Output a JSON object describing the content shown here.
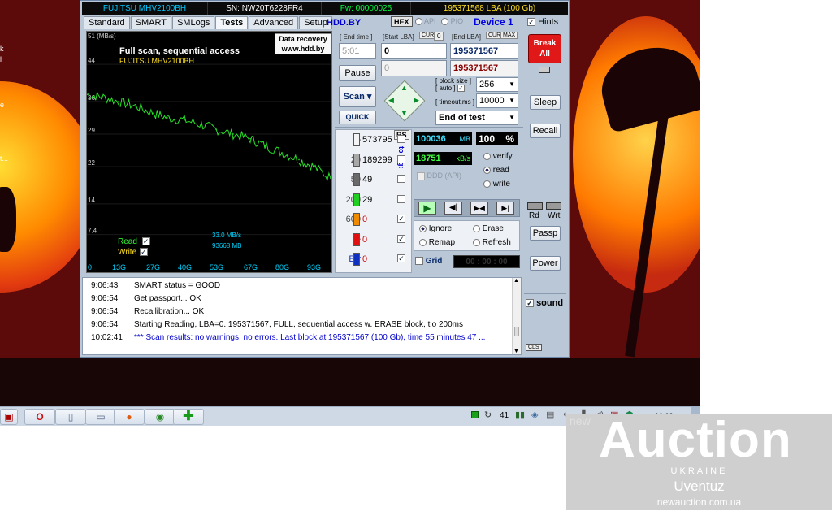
{
  "desktop": {
    "labels": [
      "k",
      "l",
      "e",
      "t..."
    ]
  },
  "header": {
    "model": "FUJITSU MHV2100BH",
    "serial": "SN: NW20T6228FR4",
    "firmware": "Fw: 00000025",
    "capacity": "195371568 LBA (100 Gb)"
  },
  "tabs": [
    "Standard",
    "SMART",
    "SMLogs",
    "Tests",
    "Advanced",
    "Setup"
  ],
  "active_tab": "Tests",
  "toolbar": {
    "site": "HDD.BY",
    "hex": "HEX",
    "api": "API",
    "pio": "PIO",
    "device": "Device 1",
    "hints": "Hints"
  },
  "graph": {
    "title": "Full scan, sequential access",
    "model": "FUJITSU MHV2100BH",
    "badge_line1": "Data recovery",
    "badge_line2": "www.hdd.by",
    "unit": "51 (MB/s)",
    "y_ticks": [
      "44",
      "36",
      "29",
      "22",
      "14",
      "7.4"
    ],
    "x_ticks": [
      "0",
      "13G",
      "27G",
      "40G",
      "53G",
      "67G",
      "80G",
      "93G"
    ],
    "speed": "33.0 MB/s",
    "position": "93668 MB",
    "read_label": "Read",
    "write_label": "Write"
  },
  "chart_data": {
    "type": "line",
    "title": "Full scan, sequential access",
    "x": [
      0,
      6,
      13,
      20,
      27,
      33,
      40,
      47,
      53,
      60,
      67,
      73,
      80,
      87,
      93,
      100
    ],
    "series": [
      {
        "name": "Read",
        "values": [
          37.5,
          37,
          36,
          35,
          33.5,
          32.5,
          32,
          31,
          30,
          29,
          28,
          26.5,
          25,
          23.5,
          22,
          19.5
        ]
      }
    ],
    "xlabel": "",
    "ylabel": "",
    "xlim": [
      0,
      100
    ],
    "ylim": [
      0,
      51
    ],
    "x_unit": "GB",
    "y_unit": "MB/s",
    "color": "#28e028"
  },
  "test": {
    "end_time_label": "[ End time ]",
    "start_lba_label": "[Start LBA]",
    "cur": "CUR",
    "zero": "0",
    "end_lba_label": "[End LBA]",
    "max": "MAX",
    "end_time": "5:01",
    "start_lba": "0",
    "end_lba": "195371567",
    "cur_lba": "0",
    "cur_end": "195371567",
    "pause": "Pause",
    "scan": "Scan",
    "quick": "QUICK",
    "block_size_label": "[ block size ]",
    "auto_label": "[ auto ]",
    "block_size": "256",
    "timeout_label": "[ timeout,ms ]",
    "timeout": "10000",
    "end_action": "End of test",
    "rs": "RS",
    "to_log": "to log:"
  },
  "legend": [
    {
      "ms": "5",
      "count": "573795",
      "color": "#f4f4f4"
    },
    {
      "ms": "20",
      "count": "189299",
      "color": "#a8a8a8"
    },
    {
      "ms": "50",
      "count": "49",
      "color": "#6a6a6a"
    },
    {
      "ms": "200",
      "count": "29",
      "color": "#20d020"
    },
    {
      "ms": "600",
      "count": "0",
      "color": "#f08a00"
    },
    {
      "ms": ">",
      "count": "0",
      "color": "#e01010"
    },
    {
      "ms": "Err",
      "count": "0",
      "color": "#1030c0"
    }
  ],
  "stats": {
    "mb": "100036",
    "mb_unit": "MB",
    "percent": "100",
    "percent_unit": "%",
    "speed": "18751",
    "speed_unit": "kB/s",
    "ddd": "DDD (API)",
    "verify": "verify",
    "read": "read",
    "write": "write"
  },
  "modes": {
    "ignore": "Ignore",
    "erase": "Erase",
    "remap": "Remap",
    "refresh": "Refresh",
    "grid": "Grid",
    "timer": "00 : 00 : 00"
  },
  "right": {
    "break_line1": "Break",
    "break_line2": "All",
    "sleep": "Sleep",
    "recall": "Recall",
    "rd": "Rd",
    "wrt": "Wrt",
    "passp": "Passp",
    "power": "Power",
    "sound": "sound",
    "cls": "CLS"
  },
  "log": [
    {
      "time": "9:06:43",
      "msg": "SMART status = GOOD"
    },
    {
      "time": "9:06:54",
      "msg": "Get passport... OK"
    },
    {
      "time": "9:06:54",
      "msg": "Recallibration... OK"
    },
    {
      "time": "9:06:54",
      "msg": "Starting Reading, LBA=0..195371567, FULL, sequential access w. ERASE block, tio 200ms"
    },
    {
      "time": "10:02:41",
      "msg": "*** Scan results: no warnings, no errors. Last block at 195371567 (100 Gb), time 55 minutes 47 ..."
    }
  ],
  "taskbar": {
    "tray_num": "41",
    "clock": "10:02"
  },
  "watermark": {
    "brand": "Auction",
    "prefix": "new",
    "country": "UKRAINE",
    "seller": "Uventuz",
    "site": "newauction.com.ua"
  }
}
